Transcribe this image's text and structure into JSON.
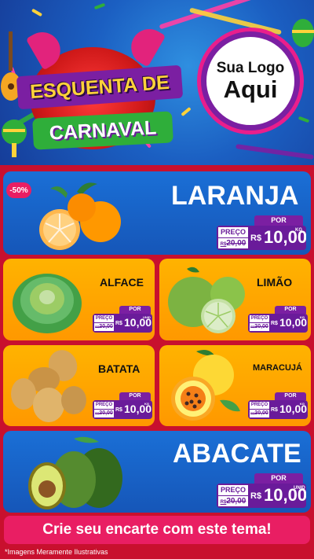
{
  "header": {
    "title_line1": "ESQUENTA DE",
    "title_line2": "CARNAVAL",
    "logo_line1": "Sua Logo",
    "logo_line2": "Aqui"
  },
  "colors": {
    "brand_purple": "#7b1fa2",
    "brand_pink": "#e91e63",
    "card_blue": "#1a6fd6",
    "card_yellow": "#ffb300",
    "background_red": "#c8102e"
  },
  "products": {
    "laranja": {
      "name": "LARANJA",
      "badge": "-50%",
      "por_label": "POR",
      "preco_label": "PREÇO",
      "old_prefix": "R$",
      "old_price": "20,00",
      "currency": "R$",
      "price": "10,00",
      "unit": "KG",
      "icon": "orange-icon"
    },
    "alface": {
      "name": "ALFACE",
      "por_label": "POR",
      "preco_label": "PREÇO",
      "old_prefix": "R$",
      "old_price": "20,00",
      "currency": "R$",
      "price": "10,00",
      "unit": "UNID",
      "icon": "lettuce-icon"
    },
    "limao": {
      "name": "LIMÃO",
      "por_label": "POR",
      "preco_label": "PREÇO",
      "old_prefix": "R$",
      "old_price": "20,00",
      "currency": "R$",
      "price": "10,00",
      "unit": "KG",
      "icon": "lime-icon"
    },
    "batata": {
      "name": "BATATA",
      "por_label": "POR",
      "preco_label": "PREÇO",
      "old_prefix": "R$",
      "old_price": "20,00",
      "currency": "R$",
      "price": "10,00",
      "unit": "KG",
      "icon": "potato-icon"
    },
    "maracuja": {
      "name": "MARACUJÁ",
      "por_label": "POR",
      "preco_label": "PREÇO",
      "old_prefix": "R$",
      "old_price": "20,00",
      "currency": "R$",
      "price": "10,00",
      "unit": "KG",
      "icon": "passion-fruit-icon"
    },
    "abacate": {
      "name": "ABACATE",
      "por_label": "POR",
      "preco_label": "PREÇO",
      "old_prefix": "R$",
      "old_price": "20,00",
      "currency": "R$",
      "price": "10,00",
      "unit": "UNID",
      "icon": "avocado-icon"
    }
  },
  "cta": {
    "label": "Crie seu encarte com este tema!"
  },
  "footer": {
    "note": "*Imagens Meramente Ilustrativas"
  }
}
